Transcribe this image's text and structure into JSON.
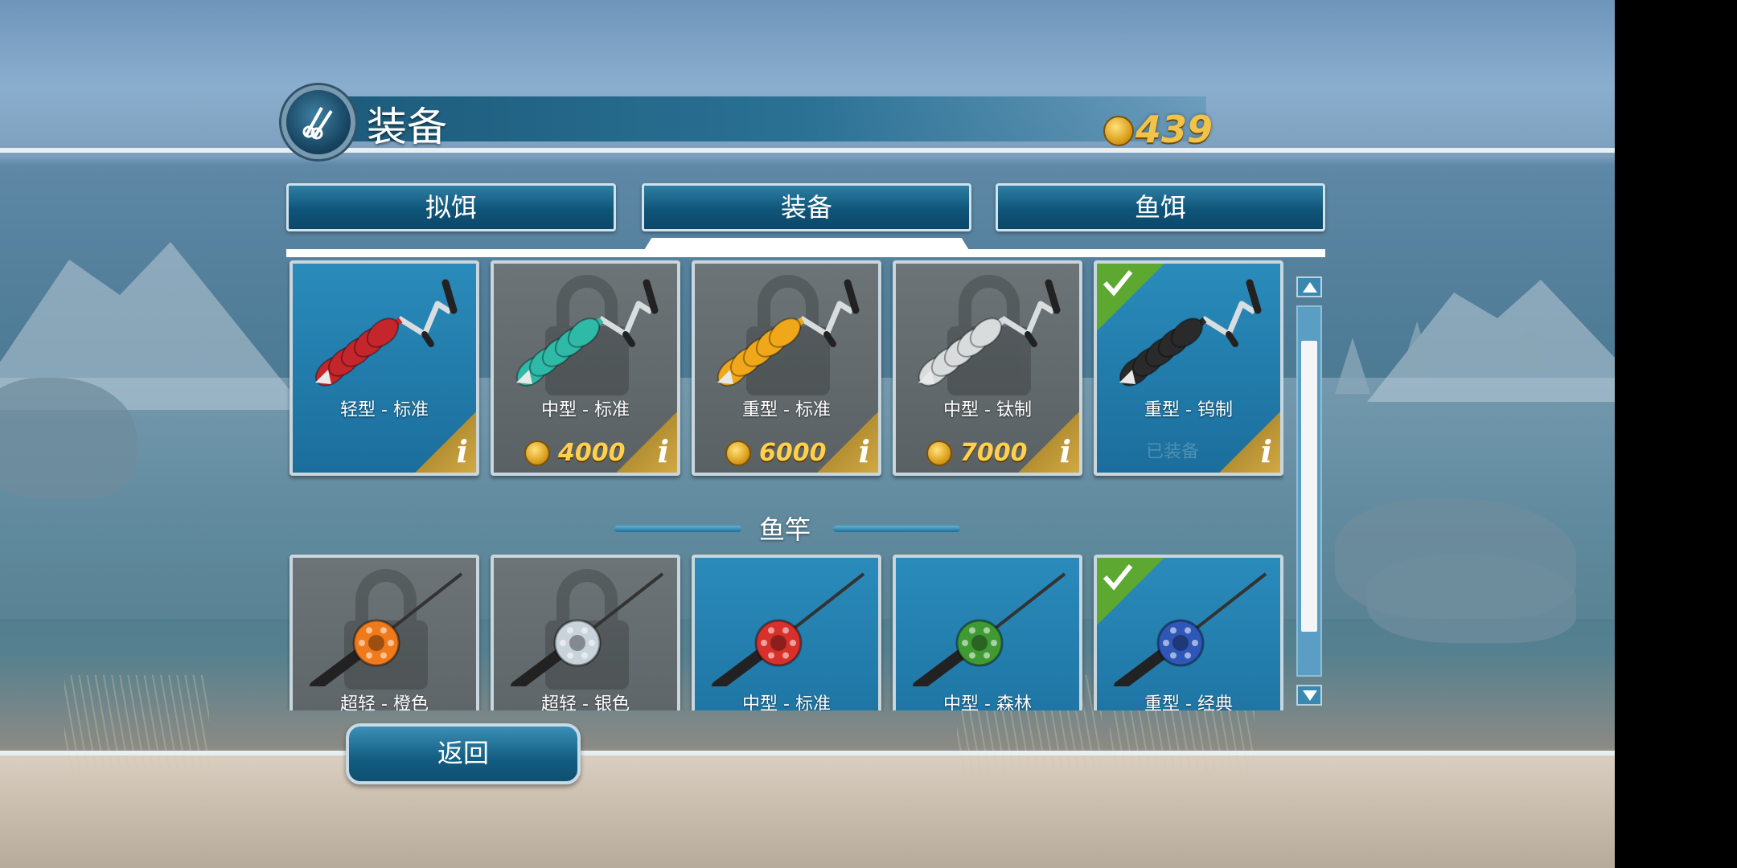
{
  "header": {
    "title": "装备",
    "coins": "439",
    "emblem_icon": "fishing-tools-icon"
  },
  "tabs": [
    {
      "label": "拟饵",
      "active": false
    },
    {
      "label": "装备",
      "active": true
    },
    {
      "label": "鱼饵",
      "active": false
    }
  ],
  "augers": [
    {
      "label": "轻型 - 标准",
      "color": "#c4262b",
      "locked": false,
      "price": "",
      "status": "",
      "equipped": false
    },
    {
      "label": "中型 - 标准",
      "color": "#2fb9a7",
      "locked": true,
      "price": "4000",
      "status": "",
      "equipped": false
    },
    {
      "label": "重型 - 标准",
      "color": "#f0a81a",
      "locked": true,
      "price": "6000",
      "status": "",
      "equipped": false
    },
    {
      "label": "中型 - 钛制",
      "color": "#d9dcdc",
      "locked": true,
      "price": "7000",
      "status": "",
      "equipped": false
    },
    {
      "label": "重型 - 钨制",
      "color": "#2a2a2a",
      "locked": false,
      "price": "",
      "status": "已装备",
      "equipped": true
    }
  ],
  "rods_section": {
    "title": "鱼竿"
  },
  "rods": [
    {
      "label": "超轻 - 橙色",
      "reel_color": "#f07a1a",
      "locked": true,
      "equipped": false
    },
    {
      "label": "超轻 - 银色",
      "reel_color": "#c9d3dc",
      "locked": true,
      "equipped": false
    },
    {
      "label": "中型 - 标准",
      "reel_color": "#d8302a",
      "locked": false,
      "equipped": false
    },
    {
      "label": "中型 - 森林",
      "reel_color": "#3f9a34",
      "locked": false,
      "equipped": false
    },
    {
      "label": "重型 - 经典",
      "reel_color": "#2f57b8",
      "locked": false,
      "equipped": true
    }
  ],
  "back_button": {
    "label": "返回"
  }
}
